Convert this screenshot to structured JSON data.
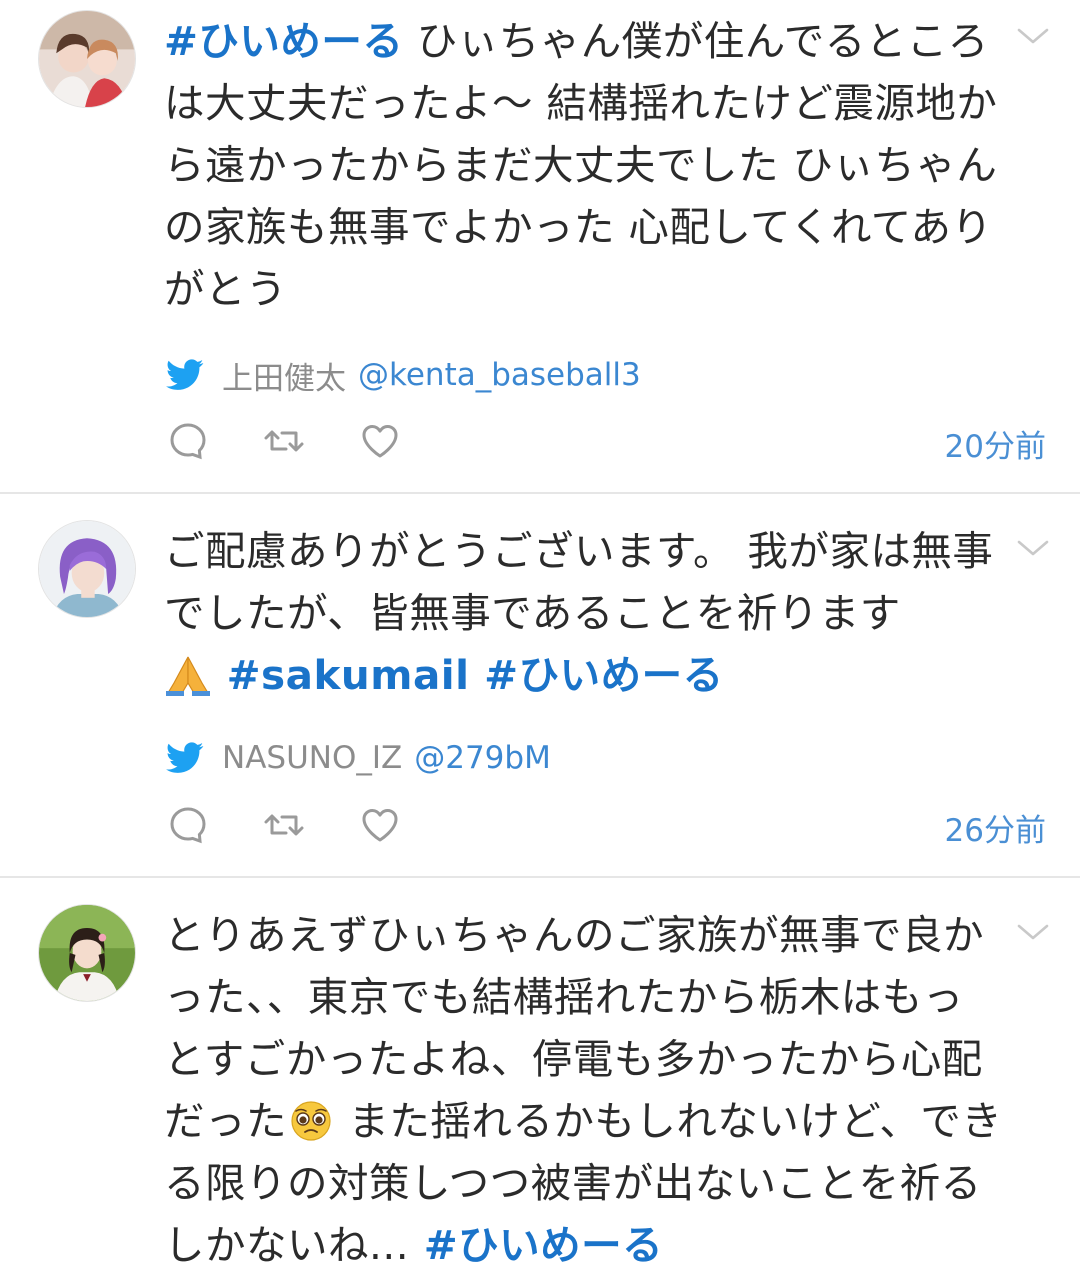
{
  "posts": [
    {
      "hashtag_lead": "#ひいめーる",
      "text": " ひぃちゃん僕が住んでるところは大丈夫だったよ〜 結構揺れたけど震源地から遠かったからまだ大丈夫でした ひぃちゃんの家族も無事でよかった 心配してくれてありがとう",
      "source_name": "上田健太",
      "source_handle": "@kenta_baseball3",
      "time": "20分前"
    },
    {
      "text": "ご配慮ありがとうございます。 我が家は無事でしたが、皆無事であることを祈ります",
      "emoji": "folded-hands",
      "hashtag_a": " #sakumail",
      "hashtag_b": " #ひいめーる",
      "source_name": "NASUNO_IZ",
      "source_handle": "@279bM",
      "time": "26分前"
    },
    {
      "text_before_emoji": "とりあえずひぃちゃんのご家族が無事で良かった、、東京でも結構揺れたから栃木はもっとすごかったよね、停電も多かったから心配だった",
      "emoji": "pleading-face",
      "text_after_emoji": " また揺れるかもしれないけど、できる限りの対策しつつ被害が出ないことを祈るしかないね...",
      "hashtag_trail": " #ひいめーる"
    }
  ],
  "colors": {
    "hashtag": "#1a73c9",
    "time": "#4a8fd4",
    "twitter_bird": "#1da1f2",
    "icons": "#9a9a9a"
  }
}
